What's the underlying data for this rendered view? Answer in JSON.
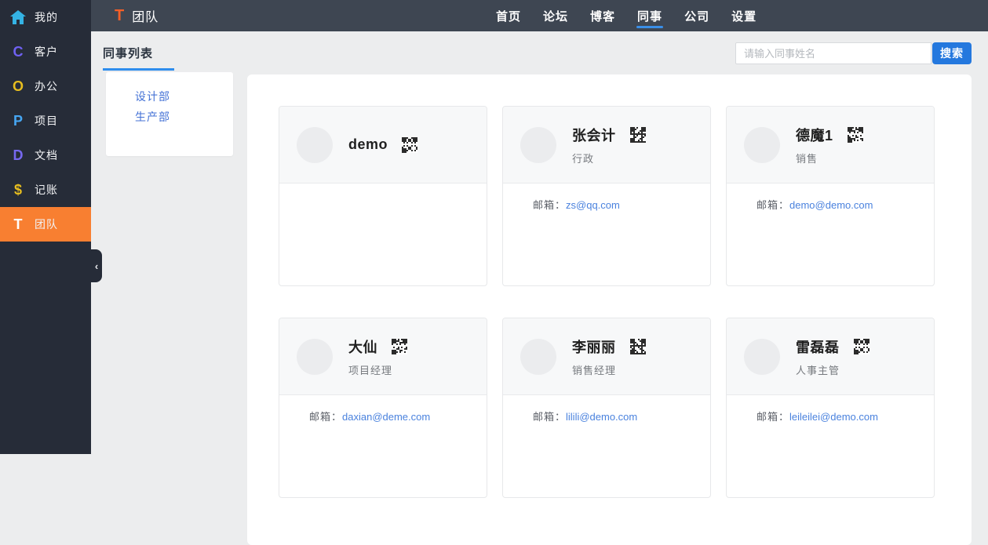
{
  "colors": {
    "accent_blue": "#2e8ded",
    "nav_underline_blue": "#3a8fe8",
    "search_button_blue": "#2478de",
    "email_link_blue": "#4a82de",
    "dept_link_blue": "#4472d6",
    "active_orange": "#f87f31",
    "logo_orange": "#f45f28"
  },
  "sidebar": {
    "items": [
      {
        "key": "home",
        "label": "我的",
        "icon": "home-icon",
        "glyph": "⌂",
        "color": "#34b3e4",
        "active": false
      },
      {
        "key": "customers",
        "label": "客户",
        "icon": "customers-icon",
        "glyph": "C",
        "color": "#6f61f2",
        "active": false
      },
      {
        "key": "office",
        "label": "办公",
        "icon": "office-icon",
        "glyph": "O",
        "color": "#e6bd1f",
        "active": false
      },
      {
        "key": "projects",
        "label": "项目",
        "icon": "projects-icon",
        "glyph": "P",
        "color": "#46a6f2",
        "active": false
      },
      {
        "key": "documents",
        "label": "文档",
        "icon": "documents-icon",
        "glyph": "D",
        "color": "#7668f0",
        "active": false
      },
      {
        "key": "accounting",
        "label": "记账",
        "icon": "accounting-icon",
        "glyph": "$",
        "color": "#e6bd1f",
        "active": false
      },
      {
        "key": "team",
        "label": "团队",
        "icon": "team-icon",
        "glyph": "T",
        "color": "#ffffff",
        "active": true
      }
    ],
    "collapse_glyph": "‹"
  },
  "topbar": {
    "logo_glyph": "T",
    "title": "团队",
    "nav": [
      {
        "key": "home",
        "label": "首页",
        "active": false
      },
      {
        "key": "forum",
        "label": "论坛",
        "active": false
      },
      {
        "key": "blog",
        "label": "博客",
        "active": false
      },
      {
        "key": "colleagues",
        "label": "同事",
        "active": true
      },
      {
        "key": "company",
        "label": "公司",
        "active": false
      },
      {
        "key": "settings",
        "label": "设置",
        "active": false
      }
    ]
  },
  "subheader": {
    "tab_label": "同事列表",
    "search_placeholder": "请输入同事姓名",
    "search_button_label": "搜索"
  },
  "departments": [
    {
      "key": "design",
      "label": "设计部"
    },
    {
      "key": "production",
      "label": "生产部"
    }
  ],
  "members": [
    {
      "name": "demo",
      "role": "",
      "email_label": "",
      "email": ""
    },
    {
      "name": "张会计",
      "role": "行政",
      "email_label": "邮箱：",
      "email": "zs@qq.com"
    },
    {
      "name": "德魔1",
      "role": "销售",
      "email_label": "邮箱：",
      "email": "demo@demo.com"
    },
    {
      "name": "大仙",
      "role": "项目经理",
      "email_label": "邮箱：",
      "email": "daxian@deme.com"
    },
    {
      "name": "李丽丽",
      "role": "销售经理",
      "email_label": "邮箱：",
      "email": "lilili@demo.com"
    },
    {
      "name": "雷磊磊",
      "role": "人事主管",
      "email_label": "邮箱：",
      "email": "leileilei@demo.com"
    }
  ]
}
